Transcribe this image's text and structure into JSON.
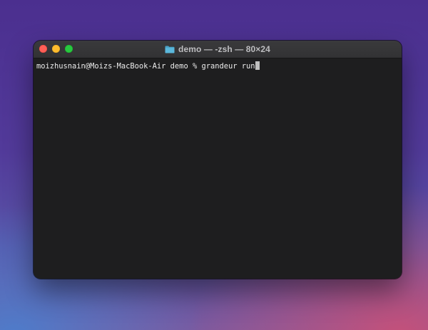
{
  "window": {
    "title": "demo — -zsh — 80×24",
    "folder_icon": "folder-icon"
  },
  "terminal": {
    "prompt": "moizhusnain@Moizs-MacBook-Air demo % ",
    "command": "grandeur run"
  },
  "colors": {
    "close": "#fe5f57",
    "minimize": "#febc2e",
    "zoom": "#28c840",
    "terminal_background": "#1e1e1f",
    "folder": "#4aa3c8"
  }
}
